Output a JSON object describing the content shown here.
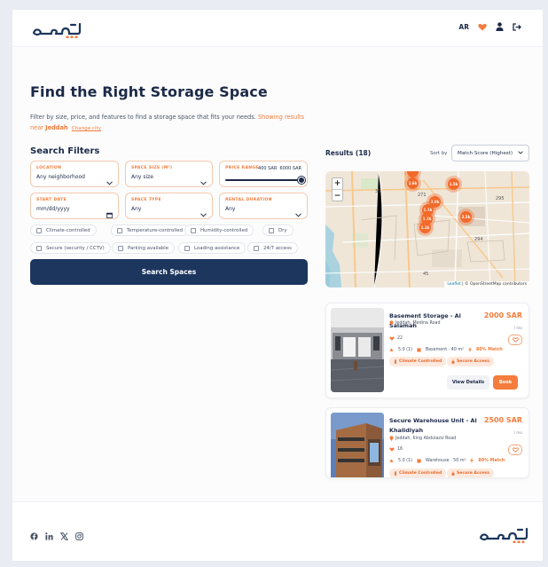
{
  "header": {
    "logo_alt": "سعة",
    "lang_label": "AR",
    "icons": [
      "heart-icon",
      "user-icon",
      "logout-icon"
    ]
  },
  "hero": {
    "title": "Find the Right Storage Space",
    "description": "Filter by size, price, and features to find a storage space that fits your needs.",
    "showing_results": "Showing results",
    "near": "near",
    "city": "Jeddah",
    "change_city": "Change city"
  },
  "filters": {
    "title": "Search Filters",
    "location": {
      "label": "LOCATION",
      "value": "Any neighborhood"
    },
    "space_size": {
      "label": "SPACE SIZE (M²)",
      "value": "Any size"
    },
    "price_range": {
      "label": "PRICE RANGE",
      "min_label": "400 SAR",
      "max_label": "6000 SAR",
      "selected_fraction": 1.0
    },
    "start_date": {
      "label": "START DATE",
      "placeholder": "mm/dd/yyyy"
    },
    "space_type": {
      "label": "SPACE TYPE",
      "value": "Any"
    },
    "rental_duration": {
      "label": "RENTAL DURATION",
      "value": "Any"
    },
    "features": [
      {
        "label": "Climate-controlled",
        "checked": false
      },
      {
        "label": "Temperature-controlled",
        "checked": false
      },
      {
        "label": "Humidity-controlled",
        "checked": false
      },
      {
        "label": "Dry",
        "checked": false
      },
      {
        "label": "Secure (security / CCTV)",
        "checked": false
      },
      {
        "label": "Parking available",
        "checked": false
      },
      {
        "label": "Loading assistance",
        "checked": false
      },
      {
        "label": "24/7 access",
        "checked": false
      }
    ],
    "search_button": "Search Spaces"
  },
  "results": {
    "title": "Results (18)",
    "sort_label": "Sort by",
    "sort_value": "Match Score (Highest)",
    "map": {
      "zoom_in": "+",
      "zoom_out": "−",
      "attribution_leaflet": "Leaflet",
      "attribution_rest": "| © OpenStreetMap contributors",
      "markers": [
        "1.6k",
        "1.5k",
        "2.0k",
        "1.1k",
        "1.1k",
        "2.5k",
        "1.1k"
      ],
      "road_labels": [
        "35",
        "271",
        "295",
        "294",
        "45"
      ]
    },
    "cards": [
      {
        "title": "Basement Storage - Al Salamah",
        "price": "2000 SAR",
        "per": "/ mo",
        "location": "Jeddah, Medina Road",
        "likes": "22",
        "rating": "5.0 (1)",
        "type_size": "Basement · 40 m²",
        "match": "80% Match",
        "tags": [
          "Climate Controlled",
          "Secure Access"
        ],
        "view_details": "View Details",
        "book": "Book"
      },
      {
        "title": "Secure Warehouse Unit - Al Khalidiyah",
        "price": "2500 SAR",
        "per": "/ mo",
        "location": "Jeddah, King Abdulaziz Road",
        "likes": "16",
        "rating": "5.0 (1)",
        "type_size": "Warehouse · 50 m²",
        "match": "80% Match",
        "tags": [
          "Climate Controlled",
          "Secure Access"
        ]
      }
    ]
  },
  "footer": {
    "social_icons": [
      "facebook-icon",
      "linkedin-icon",
      "x-icon",
      "instagram-icon"
    ],
    "logo_alt": "سعة"
  },
  "colors": {
    "navy": "#1c365e",
    "accent": "#f47c3c",
    "page_bg": "#e9ecf3"
  }
}
